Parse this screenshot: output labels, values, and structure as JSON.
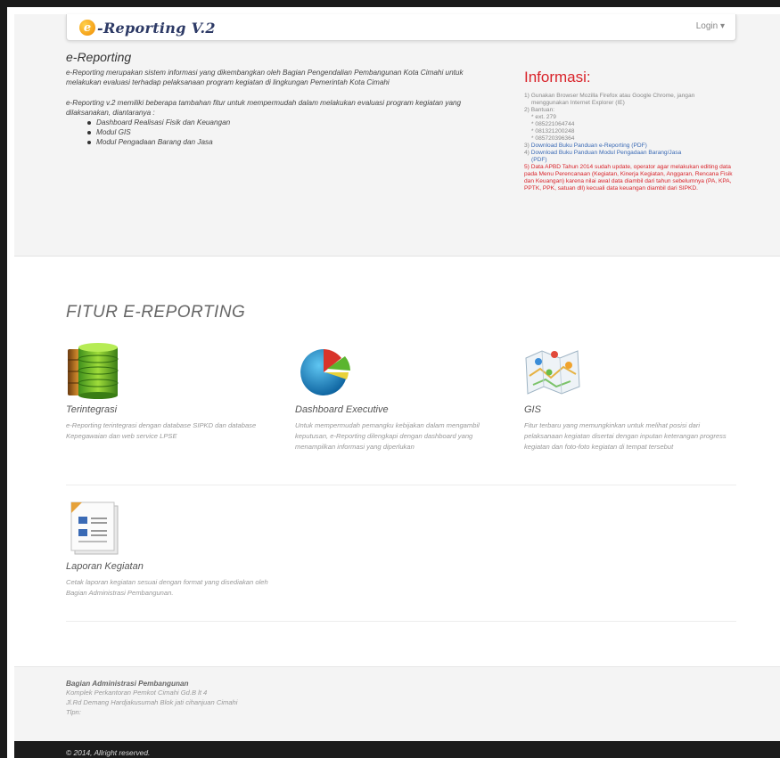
{
  "navbar": {
    "brand_letter": "e",
    "brand_text": "-Reporting V.2",
    "login_label": "Login ▾"
  },
  "intro": {
    "title": "e-Reporting",
    "paragraph1": "e-Reporting merupakan sistem informasi yang dikembangkan oleh Bagian Pengendalian Pembangunan Kota Cimahi untuk melakukan evaluasi terhadap pelaksanaan program kegiatan di lingkungan Pemerintah Kota Cimahi",
    "paragraph2": "e-Reporting v.2 memiliki beberapa tambahan fitur untuk mempermudah dalam melakukan evaluasi program kegiatan yang dilaksanakan, diantaranya :",
    "features": [
      "Dashboard Realisasi Fisik dan Keuangan",
      "Modul GIS",
      "Modul Pengadaan Barang dan Jasa"
    ]
  },
  "info": {
    "title": "Informasi:",
    "item1": "1) Gunakan Browser Mozilla Firefox atau Google Chrome, jangan",
    "item1b": "menggunakan Internet Explorer (IE)",
    "item2": "2) Bantuan:",
    "contacts": [
      "* ext. 279",
      "* 085221064744",
      "* 081321200248",
      "* 085720396364"
    ],
    "item3_prefix": "3)",
    "item3_link": "Download Buku Panduan e-Reporting (PDF)",
    "item4_prefix": "4)",
    "item4_link": "Download Buku Panduan Modul Pengadaan Barang/Jasa",
    "item4_link2": "(PDF)",
    "item5": "5) Data APBD Tahun 2014 sudah update, operator agar melakukan editing data pada Menu Perencanaan (Kegiatan, Kinerja Kegiatan, Anggaran, Rencana Fisik dan Keuangan) karena nilai awal data diambil dari tahun sebelumnya (PA, KPA, PPTK, PPK, satuan dll) kecuali data keuangan diambil dari SIPKD."
  },
  "fitur": {
    "title": "FITUR E-REPORTING",
    "items": [
      {
        "title": "Terintegrasi",
        "desc": "e-Reporting terintegrasi dengan database SIPKD dan database Kepegawaian dan web service LPSE"
      },
      {
        "title": "Dashboard Executive",
        "desc": "Untuk mempermudah pemangku kebijakan dalam mengambil keputusan, e-Reporting dilengkapi dengan dashboard yang menampilkan informasi yang diperlukan"
      },
      {
        "title": "GIS",
        "desc": "Fitur terbaru yang memungkinkan untuk melihat posisi dari pelaksanaan kegiatan disertai dengan inputan keterangan progress kegiatan dan foto-foto kegiatan di tempat tersebut"
      },
      {
        "title": "Laporan Kegiatan",
        "desc": "Cetak laporan kegiatan sesuai dengan format yang disediakan oleh Bagian Administrasi Pembangunan."
      }
    ]
  },
  "footer": {
    "org": "Bagian Administrasi Pembangunan",
    "line1": "Komplek Perkantoran Pemkot Cimahi Gd.B lt 4",
    "line2": "Jl.Rd Demang Hardjakusumah Blok jati cihanjuan Cimahi",
    "line3": "Tlpn:",
    "copyright": "© 2014, Allright reserved."
  },
  "colors": {
    "accent_red": "#d9232a",
    "link_blue": "#3a6ab5",
    "footer_dark": "#1c1c1c"
  }
}
